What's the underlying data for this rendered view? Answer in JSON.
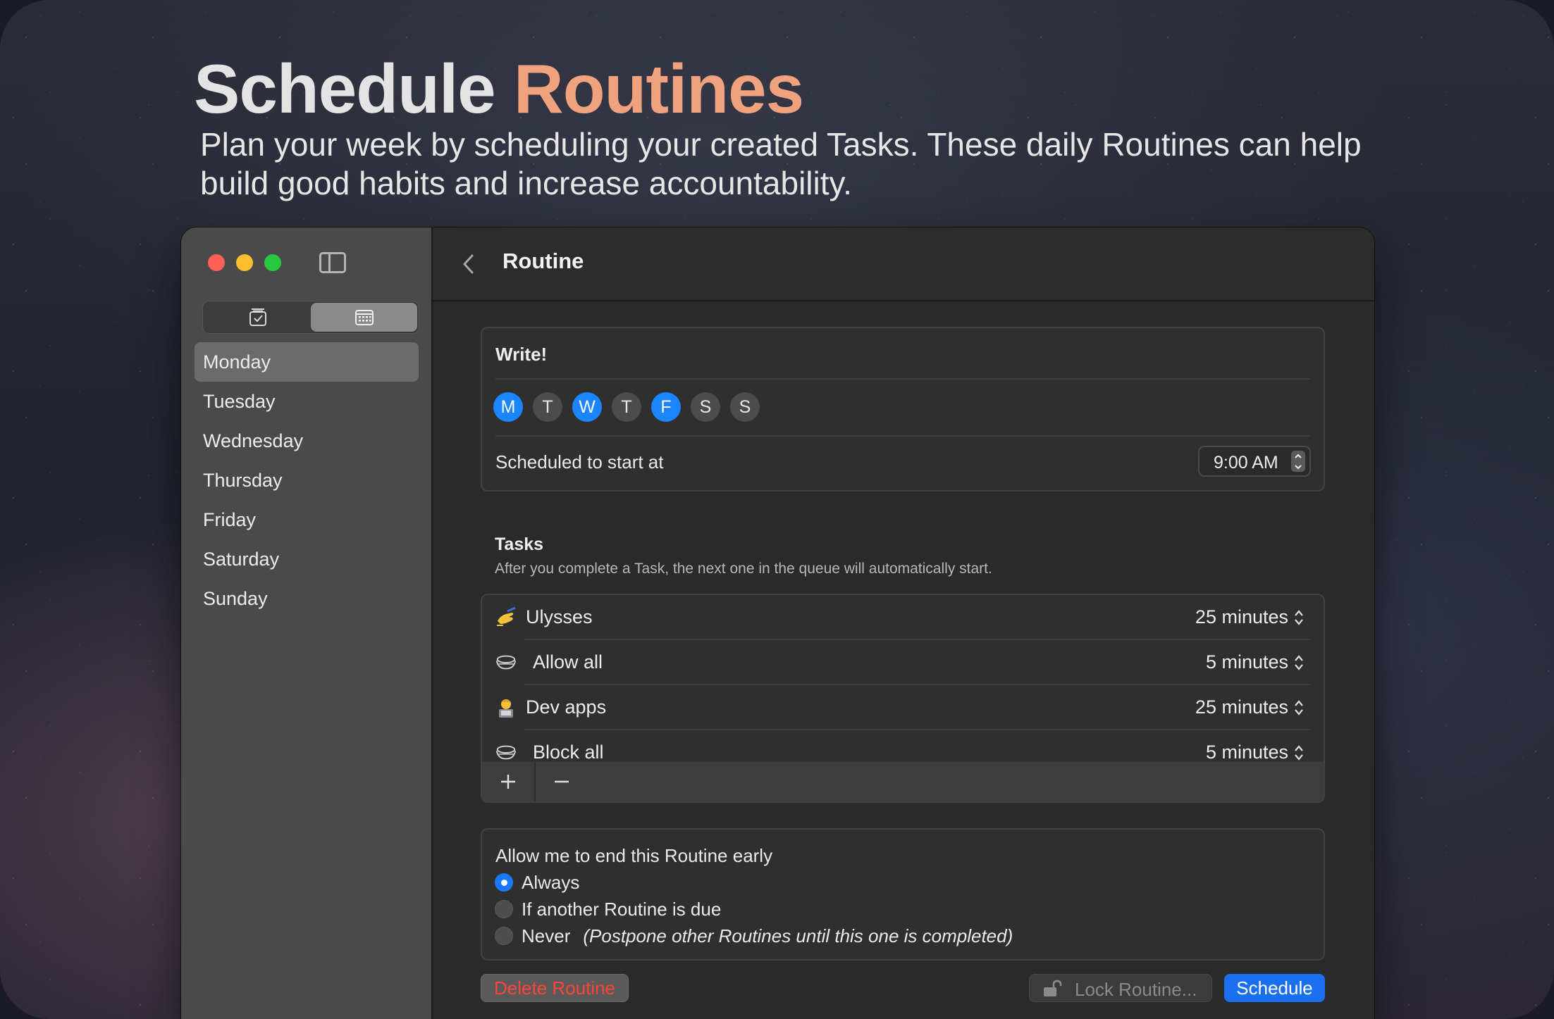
{
  "hero": {
    "title_main": "Schedule ",
    "title_accent": "Routines",
    "subtitle": "Plan your week by scheduling your created Tasks. These daily Routines can help build good habits and increase accountability."
  },
  "sidebar": {
    "segments": [
      {
        "icon": "calendar-check-icon",
        "selected": false
      },
      {
        "icon": "calendar-grid-icon",
        "selected": true
      }
    ],
    "days": [
      "Monday",
      "Tuesday",
      "Wednesday",
      "Thursday",
      "Friday",
      "Saturday",
      "Sunday"
    ],
    "selected_day": "Monday"
  },
  "header": {
    "title": "Routine"
  },
  "routine": {
    "name": "Write!",
    "weekdays": [
      {
        "label": "M",
        "active": true
      },
      {
        "label": "T",
        "active": false
      },
      {
        "label": "W",
        "active": true
      },
      {
        "label": "T",
        "active": false
      },
      {
        "label": "F",
        "active": true
      },
      {
        "label": "S",
        "active": false
      },
      {
        "label": "S",
        "active": false
      }
    ],
    "start_label": "Scheduled to start at",
    "start_time": "9:00 AM"
  },
  "tasks": {
    "heading": "Tasks",
    "description": "After you complete a Task, the next one in the queue will automatically start.",
    "items": [
      {
        "icon": "writing-hand-icon",
        "name": "Ulysses",
        "duration": "25 minutes"
      },
      {
        "icon": "bowl-icon",
        "name": "Allow all",
        "duration": "5 minutes"
      },
      {
        "icon": "technologist-icon",
        "name": "Dev apps",
        "duration": "25 minutes"
      },
      {
        "icon": "bowl-icon",
        "name": "Block all",
        "duration": "5 minutes"
      }
    ],
    "add_label": "+",
    "remove_label": "−"
  },
  "end_early": {
    "title": "Allow me to end this Routine early",
    "options": [
      {
        "label": "Always",
        "note": "",
        "selected": true
      },
      {
        "label": "If another Routine is due",
        "note": "",
        "selected": false
      },
      {
        "label": "Never",
        "note": "(Postpone other Routines until this one is completed)",
        "selected": false
      }
    ]
  },
  "actions": {
    "delete_label": "Delete Routine",
    "lock_label": "Lock Routine...",
    "schedule_label": "Schedule"
  },
  "colors": {
    "accent_title": "#f0a27e",
    "active_day": "#1a85ff",
    "schedule_button": "#1a6fef",
    "delete_text": "#ff4538"
  }
}
